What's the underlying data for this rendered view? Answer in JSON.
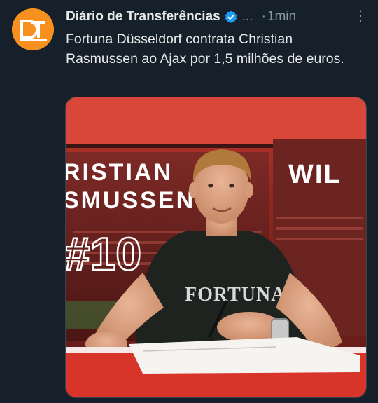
{
  "tweet": {
    "author_name": "Diário de Transferências",
    "handle": "...",
    "separator": "·",
    "timestamp": "1min",
    "more_label": "⋮",
    "text": "Fortuna Düsseldorf contrata Christian Rasmussen ao Ajax por 1,5 milhões de euros.",
    "avatar_icon": "dt-logo-icon",
    "verified_icon": "verified-badge-icon"
  },
  "media": {
    "backdrop_name_line1": "RISTIAN",
    "backdrop_name_line2": "SMUSSEN",
    "backdrop_number": "#10",
    "backdrop_right_text": "WIL",
    "shirt_text": "FORTUNA"
  },
  "colors": {
    "background": "#15202b",
    "accent": "#1d9bf0",
    "avatar_bg": "#f7901e",
    "muted": "#8b98a5"
  }
}
